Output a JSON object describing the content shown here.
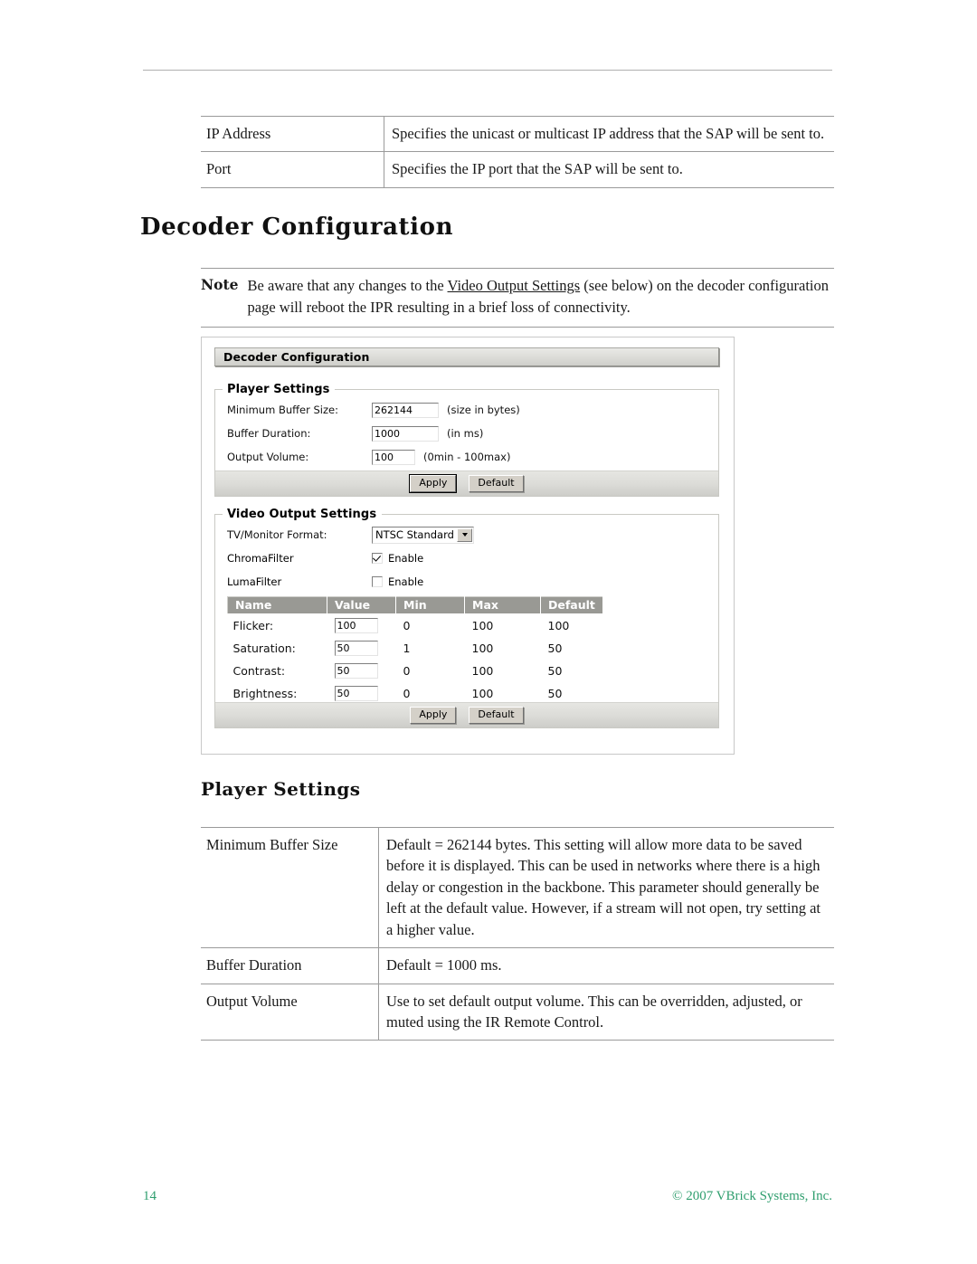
{
  "page": {
    "number": "14",
    "copyright": "© 2007 VBrick Systems, Inc."
  },
  "sap_table": {
    "rows": [
      {
        "term": "IP Address",
        "desc": "Specifies the unicast or multicast IP address that the SAP will be sent to."
      },
      {
        "term": "Port",
        "desc": "Specifies the IP port that the SAP will be sent to."
      }
    ]
  },
  "heading": {
    "main": "Decoder Configuration",
    "player_settings": "Player Settings"
  },
  "note": {
    "label": "Note",
    "text_before": "Be aware that any changes to the ",
    "link": "Video Output Settings",
    "text_after": " (see below) on the decoder configuration page will reboot the IPR resulting in a brief loss of connectivity."
  },
  "screenshot": {
    "titlebar": "Decoder Configuration",
    "player_settings": {
      "legend": "Player Settings",
      "fields": [
        {
          "label": "Minimum Buffer Size:",
          "value": "262144",
          "hint": "(size in bytes)"
        },
        {
          "label": "Buffer Duration:",
          "value": "1000",
          "hint": "(in ms)"
        },
        {
          "label": "Output Volume:",
          "value": "100",
          "hint": "(0min - 100max)"
        }
      ],
      "buttons": {
        "apply": "Apply",
        "default": "Default"
      }
    },
    "video_output_settings": {
      "legend": "Video Output Settings",
      "format": {
        "label": "TV/Monitor Format:",
        "value": "NTSC Standard"
      },
      "checkboxes": [
        {
          "label": "ChromaFilter",
          "text": "Enable",
          "checked": true
        },
        {
          "label": "LumaFilter",
          "text": "Enable",
          "checked": false
        }
      ],
      "table": {
        "headers": [
          "Name",
          "Value",
          "Min",
          "Max",
          "Default"
        ],
        "rows": [
          {
            "name": "Flicker:",
            "value": "100",
            "min": "0",
            "max": "100",
            "default": "100"
          },
          {
            "name": "Saturation:",
            "value": "50",
            "min": "1",
            "max": "100",
            "default": "50"
          },
          {
            "name": "Contrast:",
            "value": "50",
            "min": "0",
            "max": "100",
            "default": "50"
          },
          {
            "name": "Brightness:",
            "value": "50",
            "min": "0",
            "max": "100",
            "default": "50"
          }
        ]
      },
      "buttons": {
        "apply": "Apply",
        "default": "Default"
      }
    }
  },
  "player_table": {
    "rows": [
      {
        "term": "Minimum Buffer Size",
        "desc": "Default = 262144 bytes. This setting will allow more data to be saved before it is displayed. This can be used in networks where there is a high delay or congestion in the backbone. This parameter should generally be left at the default value. However, if a stream will not open, try setting at a higher value."
      },
      {
        "term": "Buffer Duration",
        "desc": "Default = 1000 ms."
      },
      {
        "term": "Output Volume",
        "desc": "Use to set default output volume. This can be overridden, adjusted, or muted using the IR Remote Control."
      }
    ]
  },
  "colors": {
    "footer_green": "#2f9e6e",
    "table_header_gray": "#999994",
    "rule_gray": "#9a9a9a"
  }
}
